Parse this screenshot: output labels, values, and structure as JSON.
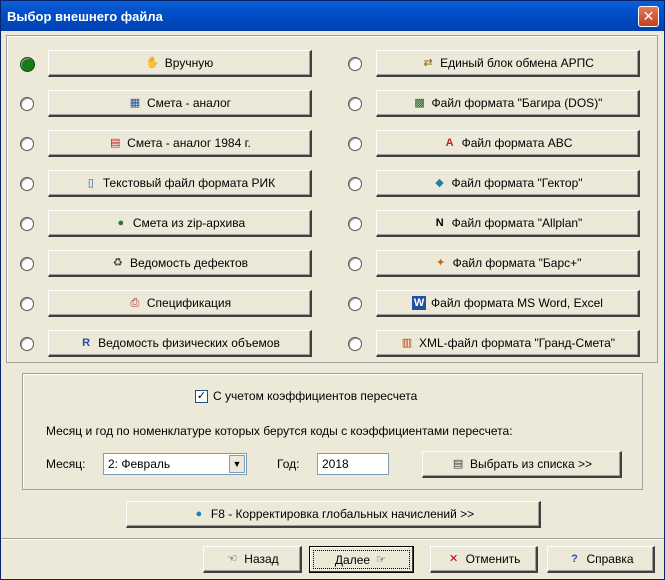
{
  "window": {
    "title": "Выбор внешнего файла",
    "close_glyph": "✕"
  },
  "left_options": [
    {
      "label": "Вручную",
      "icon": "hand-icon",
      "glyph": "✋",
      "selected": true
    },
    {
      "label": "Смета - аналог",
      "icon": "table-icon",
      "glyph": "▦",
      "selected": false
    },
    {
      "label": "Смета - аналог 1984 г.",
      "icon": "calendar-icon",
      "glyph": "▤",
      "selected": false
    },
    {
      "label": "Текстовый файл формата РИК",
      "icon": "document-icon",
      "glyph": "▯",
      "selected": false
    },
    {
      "label": "Смета из zip-архива",
      "icon": "zip-icon",
      "glyph": "●",
      "selected": false
    },
    {
      "label": "Ведомость дефектов",
      "icon": "trash-icon",
      "glyph": "♻",
      "selected": false
    },
    {
      "label": "Спецификация",
      "icon": "printer-icon",
      "glyph": "⎙",
      "selected": false
    },
    {
      "label": "Ведомость физических объемов",
      "icon": "r-icon",
      "glyph": "R",
      "selected": false
    }
  ],
  "right_options": [
    {
      "label": "Единый блок обмена АРПС",
      "icon": "exchange-icon",
      "glyph": "⇄",
      "selected": false
    },
    {
      "label": "Файл формата \"Багира (DOS)\"",
      "icon": "image-icon",
      "glyph": "▩",
      "selected": false
    },
    {
      "label": "Файл формата ABC",
      "icon": "abc-icon",
      "glyph": "A",
      "selected": false
    },
    {
      "label": "Файл формата \"Гектор\"",
      "icon": "diamond-icon",
      "glyph": "◆",
      "selected": false
    },
    {
      "label": "Файл формата \"Allplan\"",
      "icon": "allplan-icon",
      "glyph": "N",
      "selected": false
    },
    {
      "label": "Файл формата \"Барс+\"",
      "icon": "bars-icon",
      "glyph": "✦",
      "selected": false
    },
    {
      "label": "Файл формата MS Word, Excel",
      "icon": "word-excel-icon",
      "glyph": "W",
      "selected": false
    },
    {
      "label": "XML-файл формата \"Гранд-Смета\"",
      "icon": "xml-icon",
      "glyph": "▥",
      "selected": false
    }
  ],
  "recalc": {
    "checkbox_label": "С учетом коэффициентов пересчета",
    "checked": true,
    "check_glyph": "✓",
    "description": "Месяц и год по номенклатуре которых берутся коды  с коэффициентами пересчета:",
    "month_label": "Месяц:",
    "month_value": "2: Февраль",
    "year_label": "Год:",
    "year_value": "2018",
    "pick_button": "Выбрать из списка >>"
  },
  "f8_button": "F8 - Корректировка глобальных начислений >>",
  "footer": {
    "back": "Назад",
    "next": "Далее",
    "cancel": "Отменить",
    "help": "Справка"
  }
}
